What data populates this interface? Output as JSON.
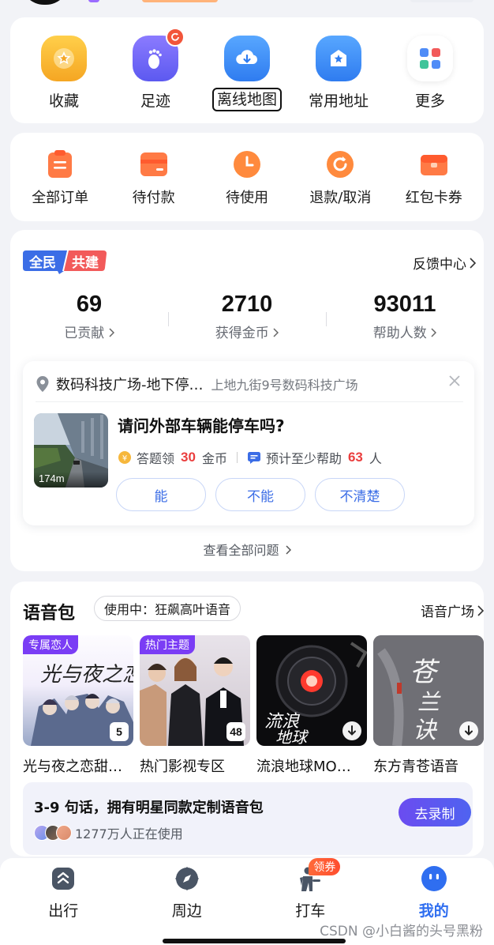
{
  "quick_entries": [
    {
      "label": "收藏",
      "icon": "star-icon",
      "color": "#f7b731"
    },
    {
      "label": "足迹",
      "icon": "footprint-icon",
      "color": "#6c6df5"
    },
    {
      "label": "离线地图",
      "icon": "download-cloud-icon",
      "color": "#3d8af7"
    },
    {
      "label": "常用地址",
      "icon": "home-pin-icon",
      "color": "#3d8af7"
    },
    {
      "label": "更多",
      "icon": "grid-icon",
      "color": "#ffffff"
    }
  ],
  "orders": [
    {
      "label": "全部订单",
      "icon": "order-list-icon"
    },
    {
      "label": "待付款",
      "icon": "wallet-icon"
    },
    {
      "label": "待使用",
      "icon": "clock-icon"
    },
    {
      "label": "退款/取消",
      "icon": "refund-icon"
    },
    {
      "label": "红包卡券",
      "icon": "coupon-icon"
    }
  ],
  "contribution": {
    "logo_left": "全民",
    "logo_right": "共建",
    "feedback_label": "反馈中心",
    "stats": [
      {
        "value": "69",
        "label": "已贡献"
      },
      {
        "value": "2710",
        "label": "获得金币"
      },
      {
        "value": "93011",
        "label": "帮助人数"
      }
    ],
    "question": {
      "place_name": "数码科技广场-地下停…",
      "place_address": "上地九街9号数码科技广场",
      "distance": "174m",
      "title": "请问外部车辆能停车吗?",
      "reward_prefix": "答题领",
      "reward_value": "30",
      "reward_unit": "金币",
      "help_prefix": "预计至少帮助",
      "help_value": "63",
      "help_unit": "人",
      "answers": [
        "能",
        "不能",
        "不清楚"
      ]
    },
    "see_all": "查看全部问题"
  },
  "voice": {
    "title": "语音包",
    "using": "使用中：狂飙高叶语音",
    "plaza": "语音广场",
    "packs": [
      {
        "name": "光与夜之恋甜…",
        "tag": "专属恋人",
        "count": "5"
      },
      {
        "name": "热门影视专区",
        "tag": "热门主题",
        "count": "48"
      },
      {
        "name": "流浪地球MO…",
        "tag": "",
        "count": ""
      },
      {
        "name": "东方青苍语音",
        "tag": "",
        "count": ""
      }
    ],
    "promo_title": "3-9 句话，拥有明星同款定制语音包",
    "promo_users": "1277万人正在使用",
    "promo_button": "去录制"
  },
  "tabbar": [
    {
      "label": "出行",
      "icon": "route-icon"
    },
    {
      "label": "周边",
      "icon": "compass-icon"
    },
    {
      "label": "打车",
      "icon": "taxi-person-icon",
      "badge": "领券"
    },
    {
      "label": "我的",
      "icon": "my-face-icon",
      "active": true
    }
  ],
  "watermark": "CSDN @小白酱的头号黑粉",
  "colors": {
    "accent": "#2f6ef0",
    "highlight": "#ea3e3e",
    "purple": "#6b4cf0"
  }
}
